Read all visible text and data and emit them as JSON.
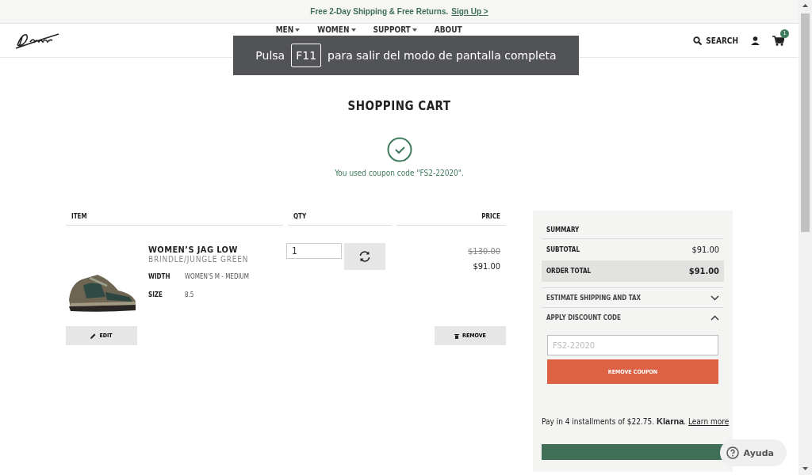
{
  "promo_bar": {
    "text": "Free 2-Day Shipping & Free Returns.",
    "link": "Sign Up >"
  },
  "header": {
    "nav": [
      {
        "label": "MEN",
        "dropdown": true
      },
      {
        "label": "WOMEN",
        "dropdown": true
      },
      {
        "label": "SUPPORT",
        "dropdown": true
      },
      {
        "label": "ABOUT",
        "dropdown": false
      }
    ],
    "search_label": "SEARCH",
    "cart_count": "1"
  },
  "fullscreen_notice": {
    "before": "Pulsa",
    "key": "F11",
    "after": "para salir del modo de pantalla completa"
  },
  "page_title": "SHOPPING CART",
  "coupon_message": "You used coupon code \"FS2-22020\".",
  "cart": {
    "columns": [
      "ITEM",
      "QTY",
      "PRICE"
    ],
    "items": [
      {
        "name": "WOMEN’S JAG LOW",
        "variant": "BRINDLE/JUNGLE GREEN",
        "attributes": [
          {
            "label": "WIDTH",
            "value": "WOMEN'S M - MEDIUM"
          },
          {
            "label": "SIZE",
            "value": "8.5"
          }
        ],
        "qty": "1",
        "original_price": "$130.00",
        "price": "$91.00",
        "edit_label": "EDIT",
        "remove_label": "REMOVE"
      }
    ]
  },
  "summary": {
    "title": "SUMMARY",
    "rows": [
      {
        "label": "SUBTOTAL",
        "value": "$91.00",
        "highlighted": false
      },
      {
        "label": "ORDER TOTAL",
        "value": "$91.00",
        "highlighted": true
      }
    ],
    "sections": [
      {
        "label": "ESTIMATE SHIPPING AND TAX",
        "expanded": false
      },
      {
        "label": "APPLY DISCOUNT CODE",
        "expanded": true
      }
    ],
    "discount_placeholder": "FS2-22020",
    "remove_coupon_label": "REMOVE COUPON",
    "installments": {
      "text": "Pay in 4 installments of $22.75.",
      "brand": "Klarna",
      "brand_suffix": ".",
      "link": "Learn more"
    }
  },
  "help_button": "Ayuda"
}
